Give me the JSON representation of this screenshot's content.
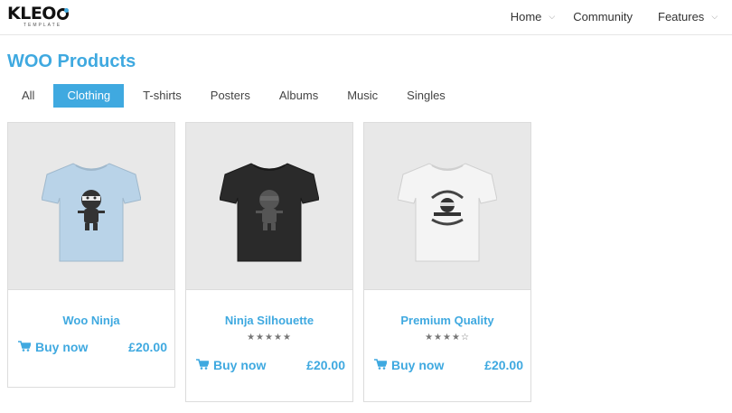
{
  "header": {
    "logo_text": "KLEO",
    "logo_sub": "TEMPLATE",
    "nav": [
      {
        "label": "Home"
      },
      {
        "label": "Community"
      },
      {
        "label": "Features"
      }
    ]
  },
  "main": {
    "title": "WOO Products",
    "filters": [
      {
        "label": "All"
      },
      {
        "label": "Clothing"
      },
      {
        "label": "T-shirts"
      },
      {
        "label": "Posters"
      },
      {
        "label": "Albums"
      },
      {
        "label": "Music"
      },
      {
        "label": "Singles"
      }
    ],
    "active_filter": "Clothing",
    "products": [
      {
        "name": "Woo Ninja",
        "price": "£20.00",
        "buy_label": "Buy now",
        "rating": null,
        "shirt_color": "#b9d3e8"
      },
      {
        "name": "Ninja Silhouette",
        "price": "£20.00",
        "buy_label": "Buy now",
        "rating": "★★★★★",
        "shirt_color": "#2a2a2a"
      },
      {
        "name": "Premium Quality",
        "price": "£20.00",
        "buy_label": "Buy now",
        "rating": "★★★★☆",
        "shirt_color": "#f2f2f2"
      }
    ]
  },
  "colors": {
    "accent": "#3fa9e0"
  }
}
